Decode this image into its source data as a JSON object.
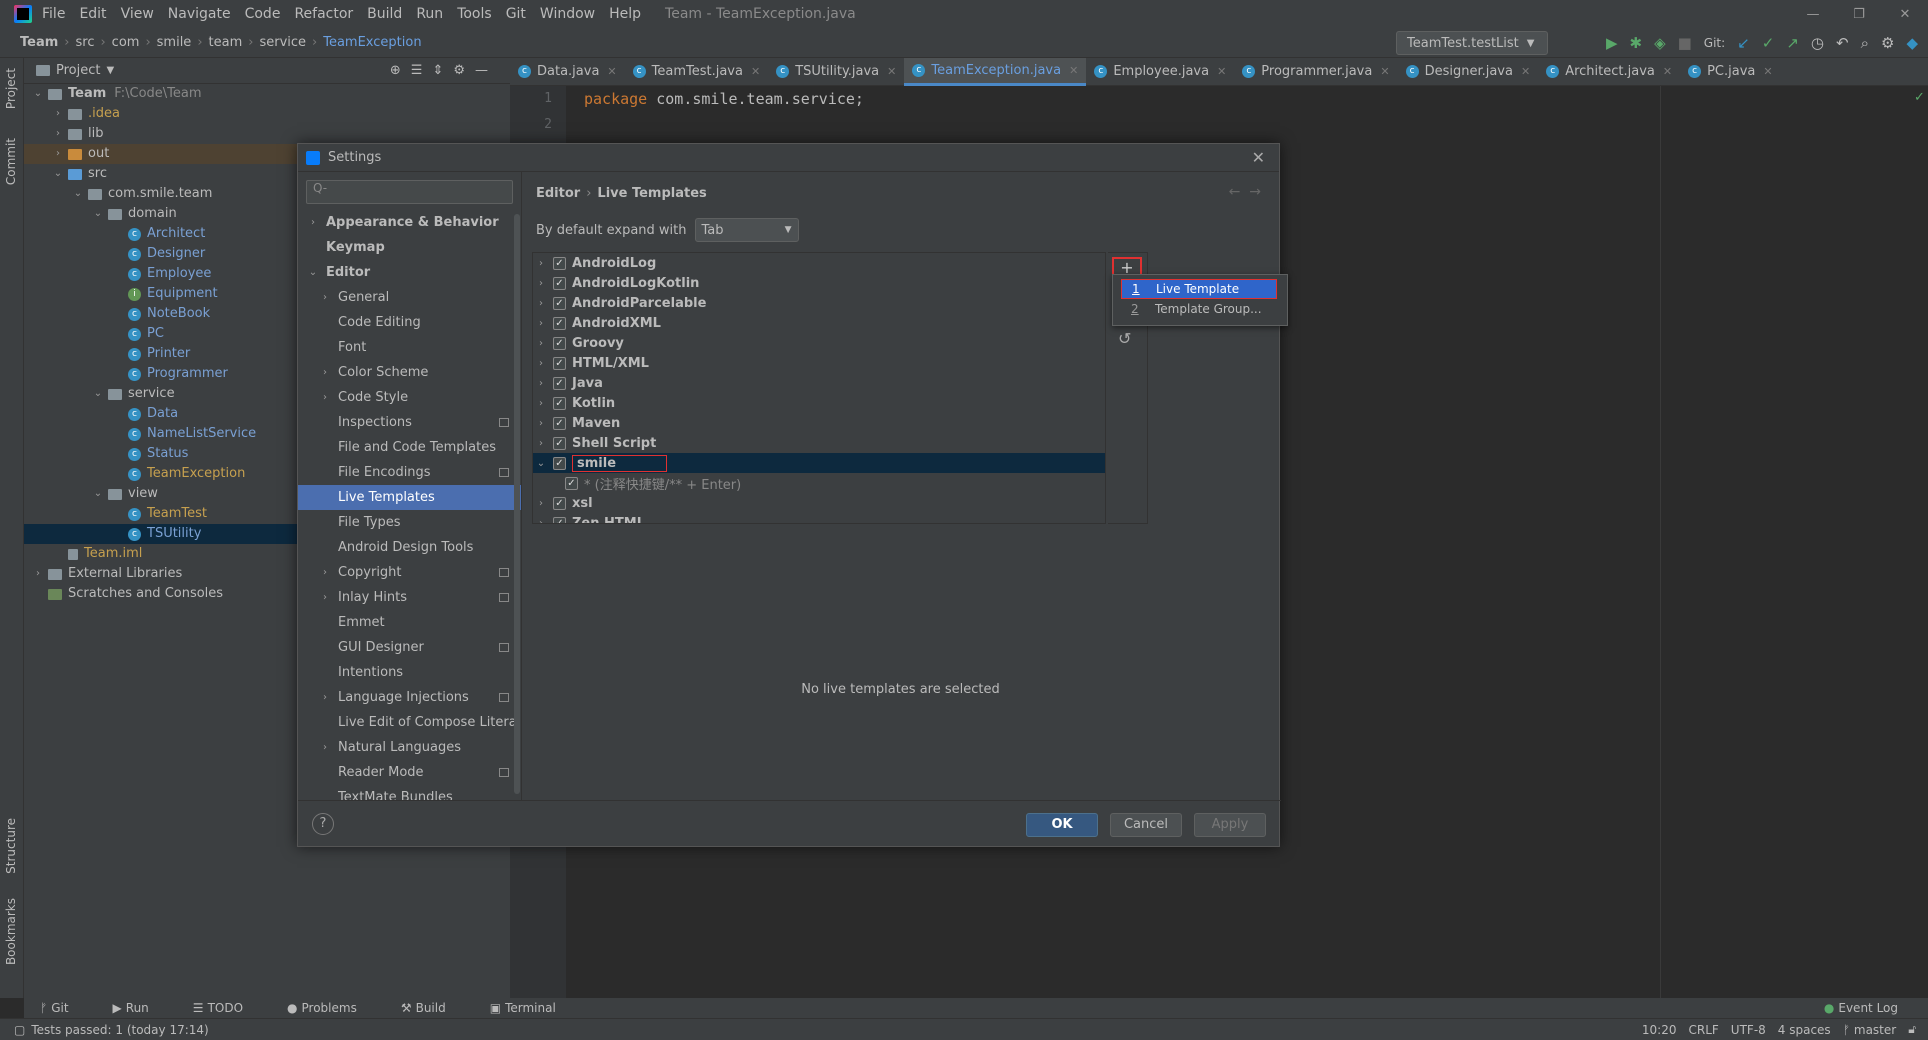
{
  "menubar": {
    "items": [
      "File",
      "Edit",
      "View",
      "Navigate",
      "Code",
      "Refactor",
      "Build",
      "Run",
      "Tools",
      "Git",
      "Window",
      "Help"
    ],
    "window_title": "Team - TeamException.java"
  },
  "navbar": {
    "crumbs": [
      "Team",
      "src",
      "com",
      "smile",
      "team",
      "service",
      "TeamException"
    ],
    "run_config": "TeamTest.testList",
    "git_label": "Git:"
  },
  "project": {
    "header": "Project",
    "tree": [
      {
        "label": "Team",
        "note": "F:\\Code\\Team",
        "level": 0,
        "type": "folder",
        "open": true
      },
      {
        "label": ".idea",
        "level": 1,
        "type": "folder",
        "open": false
      },
      {
        "label": "lib",
        "level": 1,
        "type": "folder",
        "open": false
      },
      {
        "label": "out",
        "level": 1,
        "type": "folder",
        "open": false
      },
      {
        "label": "src",
        "level": 1,
        "type": "folder",
        "open": true
      },
      {
        "label": "com.smile.team",
        "level": 2,
        "type": "folder",
        "open": true
      },
      {
        "label": "domain",
        "level": 3,
        "type": "folder",
        "open": true
      },
      {
        "label": "Architect",
        "level": 4,
        "type": "class"
      },
      {
        "label": "Designer",
        "level": 4,
        "type": "class"
      },
      {
        "label": "Employee",
        "level": 4,
        "type": "class"
      },
      {
        "label": "Equipment",
        "level": 4,
        "type": "interface"
      },
      {
        "label": "NoteBook",
        "level": 4,
        "type": "class"
      },
      {
        "label": "PC",
        "level": 4,
        "type": "class"
      },
      {
        "label": "Printer",
        "level": 4,
        "type": "class"
      },
      {
        "label": "Programmer",
        "level": 4,
        "type": "class"
      },
      {
        "label": "service",
        "level": 3,
        "type": "folder",
        "open": true
      },
      {
        "label": "Data",
        "level": 4,
        "type": "class"
      },
      {
        "label": "NameListService",
        "level": 4,
        "type": "class"
      },
      {
        "label": "Status",
        "level": 4,
        "type": "class"
      },
      {
        "label": "TeamException",
        "level": 4,
        "type": "class"
      },
      {
        "label": "view",
        "level": 3,
        "type": "folder",
        "open": true
      },
      {
        "label": "TeamTest",
        "level": 4,
        "type": "class"
      },
      {
        "label": "TSUtility",
        "level": 4,
        "type": "class"
      },
      {
        "label": "Team.iml",
        "level": 1,
        "type": "file"
      },
      {
        "label": "External Libraries",
        "level": 0,
        "type": "lib",
        "open": false
      },
      {
        "label": "Scratches and Consoles",
        "level": 0,
        "type": "scratch"
      }
    ]
  },
  "side_labels": {
    "project": "Project",
    "commit": "Commit",
    "structure": "Structure",
    "bookmarks": "Bookmarks"
  },
  "tabs": [
    "Data.java",
    "TeamTest.java",
    "TSUtility.java",
    "TeamException.java",
    "Employee.java",
    "Programmer.java",
    "Designer.java",
    "Architect.java",
    "PC.java"
  ],
  "editor": {
    "line1": "1",
    "line2": "2",
    "kw": "package",
    "pkg": " com.smile.team.service;"
  },
  "dialog": {
    "title": "Settings",
    "search_placeholder": "Q-",
    "sidebar": [
      {
        "label": "Appearance & Behavior",
        "bold": true,
        "chev": true,
        "indent": 0
      },
      {
        "label": "Keymap",
        "bold": true,
        "indent": 0
      },
      {
        "label": "Editor",
        "bold": true,
        "chev": true,
        "open": true,
        "indent": 0
      },
      {
        "label": "General",
        "chev": true,
        "indent": 1
      },
      {
        "label": "Code Editing",
        "indent": 1
      },
      {
        "label": "Font",
        "indent": 1
      },
      {
        "label": "Color Scheme",
        "chev": true,
        "indent": 1
      },
      {
        "label": "Code Style",
        "chev": true,
        "indent": 1
      },
      {
        "label": "Inspections",
        "indent": 1,
        "badge": true
      },
      {
        "label": "File and Code Templates",
        "indent": 1
      },
      {
        "label": "File Encodings",
        "indent": 1,
        "badge": true
      },
      {
        "label": "Live Templates",
        "indent": 1,
        "selected": true
      },
      {
        "label": "File Types",
        "indent": 1
      },
      {
        "label": "Android Design Tools",
        "indent": 1
      },
      {
        "label": "Copyright",
        "chev": true,
        "indent": 1,
        "badge": true
      },
      {
        "label": "Inlay Hints",
        "chev": true,
        "indent": 1,
        "badge": true
      },
      {
        "label": "Emmet",
        "indent": 1
      },
      {
        "label": "GUI Designer",
        "indent": 1,
        "badge": true
      },
      {
        "label": "Intentions",
        "indent": 1
      },
      {
        "label": "Language Injections",
        "chev": true,
        "indent": 1,
        "badge": true
      },
      {
        "label": "Live Edit of Compose Litera",
        "indent": 1
      },
      {
        "label": "Natural Languages",
        "chev": true,
        "indent": 1
      },
      {
        "label": "Reader Mode",
        "indent": 1,
        "badge": true
      },
      {
        "label": "TextMate Bundles",
        "indent": 1
      }
    ],
    "breadcrumb": [
      "Editor",
      "Live Templates"
    ],
    "expand_label": "By default expand with",
    "expand_value": "Tab",
    "templates": [
      {
        "label": "AndroidLog"
      },
      {
        "label": "AndroidLogKotlin"
      },
      {
        "label": "AndroidParcelable"
      },
      {
        "label": "AndroidXML"
      },
      {
        "label": "Groovy"
      },
      {
        "label": "HTML/XML"
      },
      {
        "label": "Java"
      },
      {
        "label": "Kotlin"
      },
      {
        "label": "Maven"
      },
      {
        "label": "Shell Script"
      },
      {
        "label": "smile",
        "open": true,
        "selected": true
      },
      {
        "label": "* (注释快捷键/** + Enter)",
        "child": true
      },
      {
        "label": "xsl"
      },
      {
        "label": "Zen HTML"
      }
    ],
    "popup": [
      {
        "num": "1",
        "label": "Live Template",
        "selected": true
      },
      {
        "num": "2",
        "label": "Template Group..."
      }
    ],
    "empty_text": "No live templates are selected",
    "ok": "OK",
    "cancel": "Cancel",
    "apply": "Apply",
    "help": "?"
  },
  "toolwindows": [
    "Git",
    "Run",
    "TODO",
    "Problems",
    "Build",
    "Terminal"
  ],
  "event_log": "Event Log",
  "status": {
    "left": "Tests passed: 1 (today 17:14)",
    "pos": "10:20",
    "eol": "CRLF",
    "enc": "UTF-8",
    "indent": "4 spaces",
    "branch": "master"
  }
}
